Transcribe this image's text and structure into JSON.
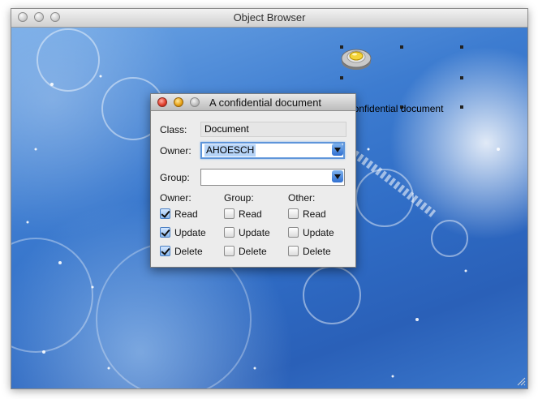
{
  "window": {
    "title": "Object Browser"
  },
  "desktop_icon": {
    "label": "A confidential document"
  },
  "dialog": {
    "title": "A confidential document",
    "class_label": "Class:",
    "class_value": "Document",
    "owner_label": "Owner:",
    "owner_value": "AHOESCH",
    "group_label": "Group:",
    "group_value": "",
    "permissions": {
      "owner_header": "Owner:",
      "group_header": "Group:",
      "other_header": "Other:",
      "owner": [
        {
          "label": "Read",
          "checked": true
        },
        {
          "label": "Update",
          "checked": true
        },
        {
          "label": "Delete",
          "checked": true
        }
      ],
      "group": [
        {
          "label": "Read",
          "checked": false
        },
        {
          "label": "Update",
          "checked": false
        },
        {
          "label": "Delete",
          "checked": false
        }
      ],
      "other": [
        {
          "label": "Read",
          "checked": false
        },
        {
          "label": "Update",
          "checked": false
        },
        {
          "label": "Delete",
          "checked": false
        }
      ]
    }
  },
  "icons": {
    "close": "close-icon",
    "minimize": "minimize-icon",
    "zoom": "zoom-icon",
    "document": "document-icon",
    "dropdown": "chevron-down-icon",
    "checkmark": "checkmark-icon",
    "resize": "resize-grip-icon"
  }
}
